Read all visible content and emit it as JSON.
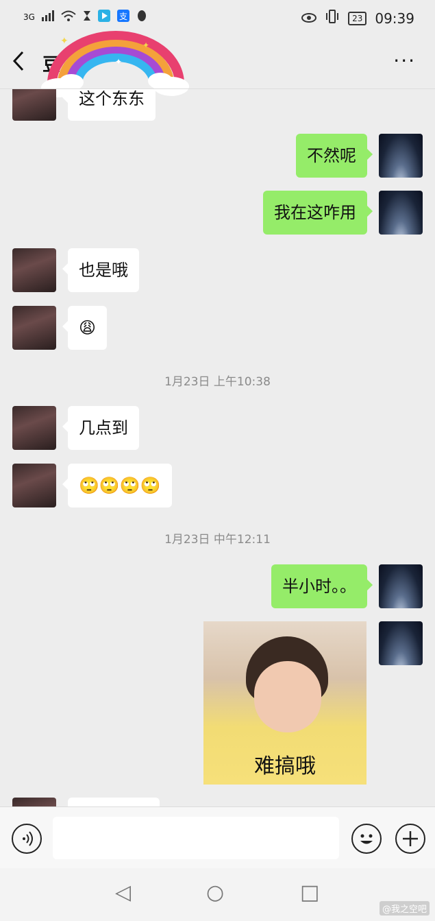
{
  "status_bar": {
    "network": "3G",
    "battery": "23",
    "time": "09:39"
  },
  "header": {
    "title": "豆",
    "more": "···"
  },
  "timestamps": [
    "1月23日 上午10:38",
    "1月23日 中午12:11"
  ],
  "messages": [
    {
      "side": "in",
      "text": "这个东东"
    },
    {
      "side": "out",
      "text": "不然呢"
    },
    {
      "side": "out",
      "text": "我在这咋用"
    },
    {
      "side": "in",
      "text": "也是哦"
    },
    {
      "side": "in",
      "text": "😩"
    },
    {
      "side": "in",
      "text": "几点到"
    },
    {
      "side": "in",
      "text": "🙄🙄🙄🙄"
    },
    {
      "side": "out",
      "text": "半小时。。"
    }
  ],
  "sticker": {
    "caption": "难搞哦"
  },
  "icons": {
    "voice": "voice-icon",
    "emoji": "emoji-icon",
    "plus": "plus-icon",
    "back": "back-arrow-icon"
  },
  "nav": {
    "back": "◁",
    "home": "○",
    "recent": "□"
  },
  "watermark": "@我之空吧",
  "colors": {
    "outgoing_bubble": "#95ec69",
    "incoming_bubble": "#ffffff",
    "background": "#ededed"
  }
}
